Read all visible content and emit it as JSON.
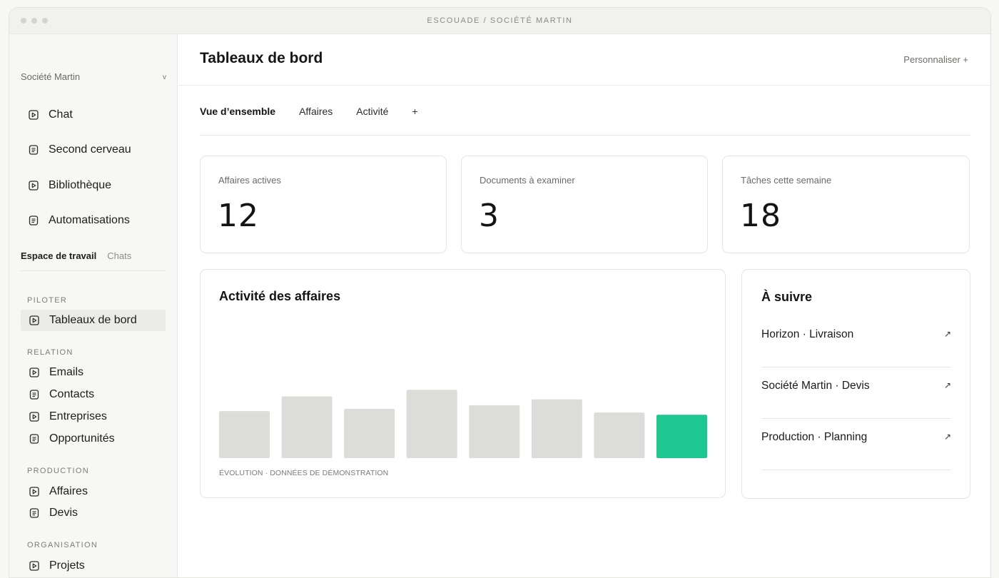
{
  "window": {
    "title": "ESCOUADE / SOCIÉTÉ MARTIN"
  },
  "sidebar": {
    "org": {
      "name": "Société Martin",
      "chevron": "v"
    },
    "main_items": [
      {
        "label": "Chat",
        "icon": "play-square-icon"
      },
      {
        "label": "Second cerveau",
        "icon": "document-icon"
      },
      {
        "label": "Bibliothèque",
        "icon": "play-square-icon"
      },
      {
        "label": "Automatisations",
        "icon": "document-icon"
      }
    ],
    "tabs": [
      {
        "label": "Espace de travail",
        "active": true
      },
      {
        "label": "Chats",
        "active": false
      }
    ],
    "sections": [
      {
        "label": "PILOTER",
        "items": [
          {
            "label": "Tableaux de bord",
            "icon": "play-square-icon",
            "active": true
          }
        ]
      },
      {
        "label": "RELATION",
        "items": [
          {
            "label": "Emails",
            "icon": "play-square-icon"
          },
          {
            "label": "Contacts",
            "icon": "document-icon"
          },
          {
            "label": "Entreprises",
            "icon": "play-square-icon"
          },
          {
            "label": "Opportunités",
            "icon": "document-icon"
          }
        ]
      },
      {
        "label": "PRODUCTION",
        "items": [
          {
            "label": "Affaires",
            "icon": "play-square-icon"
          },
          {
            "label": "Devis",
            "icon": "document-icon"
          }
        ]
      },
      {
        "label": "ORGANISATION",
        "items": [
          {
            "label": "Projets",
            "icon": "play-square-icon"
          }
        ]
      }
    ]
  },
  "header": {
    "title": "Tableaux de bord",
    "customize_label": "Personnaliser +"
  },
  "tabs": [
    {
      "label": "Vue d’ensemble",
      "active": true
    },
    {
      "label": "Affaires",
      "active": false
    },
    {
      "label": "Activité",
      "active": false
    }
  ],
  "tab_add_label": "+",
  "stats": [
    {
      "label": "Affaires actives",
      "value": "12"
    },
    {
      "label": "Documents à examiner",
      "value": "3"
    },
    {
      "label": "Tâches cette semaine",
      "value": "18"
    }
  ],
  "chart": {
    "title": "Activité des affaires",
    "caption": "ÉVOLUTION · DONNÉES DE DÉMONSTRATION"
  },
  "chart_data": {
    "type": "bar",
    "title": "Activité des affaires",
    "categories": [
      "",
      "",
      "",
      "",
      "",
      "",
      "",
      ""
    ],
    "values": [
      64,
      84,
      67,
      93,
      72,
      80,
      62,
      59
    ],
    "ylim": [
      0,
      200
    ],
    "grid": false,
    "legend": "none",
    "colors": {
      "default": "#dcddd8",
      "highlight": "#1ec690"
    },
    "highlight_index": 7
  },
  "follow": {
    "title": "À suivre",
    "items": [
      {
        "label": "Horizon · Livraison",
        "arrow": "↗"
      },
      {
        "label": "Société Martin · Devis",
        "arrow": "↗"
      },
      {
        "label": "Production · Planning",
        "arrow": "↗"
      }
    ]
  }
}
